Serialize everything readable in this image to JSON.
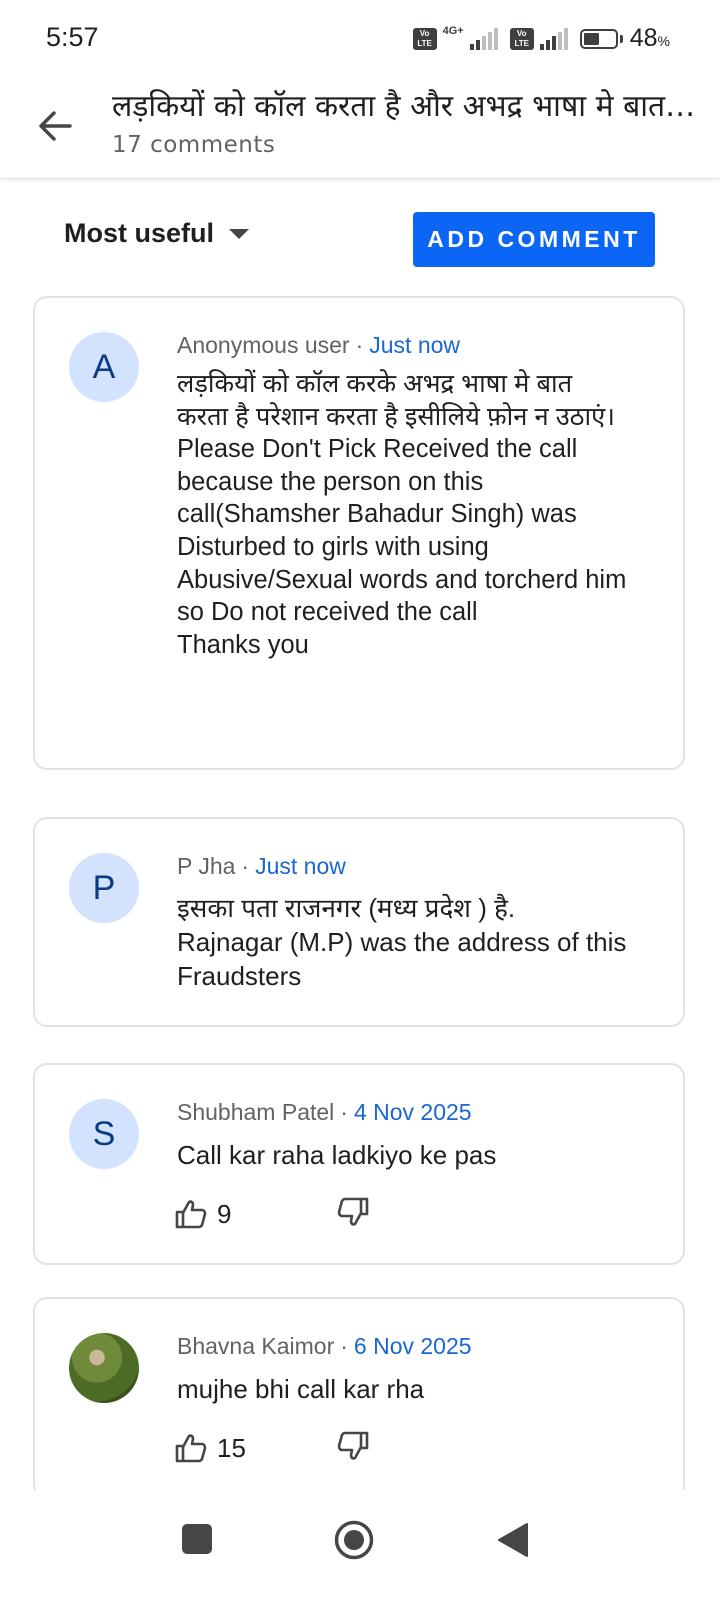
{
  "status_bar": {
    "time": "5:57",
    "network": "4G+",
    "volte": "Vo LTE",
    "battery_percent": "48",
    "battery_unit": "%"
  },
  "header": {
    "title": "लड़कियों को कॉल करता है और अभद्र भाषा मे बात करता है",
    "subtitle": "17 comments"
  },
  "toolbar": {
    "sort_label": "Most useful",
    "add_comment_label": "ADD COMMENT"
  },
  "comments": [
    {
      "avatar_letter": "A",
      "author": "Anonymous user",
      "separator": "·",
      "time": "Just now",
      "text": "लड़कियों को कॉल करके अभद्र भाषा मे बात करता  है परेशान करता है इसीलिये फ़ोन न उठाएं।\nPlease Don't Pick Received the call because the person on this call(Shamsher Bahadur Singh) was Disturbed to girls with using Abusive/Sexual words and torcherd him so Do not received the call\nThanks you"
    },
    {
      "avatar_letter": "P",
      "author": "P Jha",
      "separator": "·",
      "time": "Just now",
      "text": "इसका पता राजनगर (मध्य प्रदेश ) है.\nRajnagar (M.P) was the address of this Fraudsters"
    },
    {
      "avatar_letter": "S",
      "author": "Shubham Patel",
      "separator": "·",
      "time": "4 Nov 2025",
      "text": "Call kar raha ladkiyo ke pas",
      "likes": "9"
    },
    {
      "avatar_letter": "",
      "author": "Bhavna Kaimor",
      "separator": "·",
      "time": "6 Nov 2025",
      "text": "mujhe bhi call kar rha",
      "likes": "15"
    }
  ],
  "colors": {
    "accent": "#0b66f6",
    "link": "#1a66d2",
    "avatar_bg": "#d3e3fd",
    "card_border": "#e3e3e3"
  }
}
